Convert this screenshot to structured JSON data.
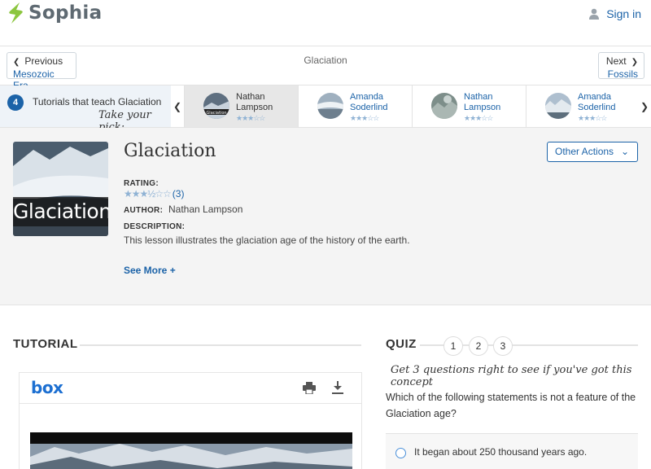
{
  "brand": {
    "name": "Sophia",
    "logo_color": "#8cc63f",
    "text_color": "#5f6a72"
  },
  "header": {
    "signin_label": "Sign in"
  },
  "nav": {
    "prev_label": "Previous",
    "prev_target": "Mesozoic Era",
    "current": "Glaciation",
    "next_label": "Next",
    "next_target": "Fossils"
  },
  "strip": {
    "count": "4",
    "label": "Tutorials that teach Glaciation",
    "handwritten": "Take your pick:",
    "tutorials": [
      {
        "first": "Nathan",
        "last": "Lampson",
        "stars": "★★★☆☆",
        "active": true
      },
      {
        "first": "Amanda",
        "last": "Soderlind",
        "stars": "★★★☆☆",
        "active": false
      },
      {
        "first": "Nathan",
        "last": "Lampson",
        "stars": "★★★☆☆",
        "active": false
      },
      {
        "first": "Amanda",
        "last": "Soderlind",
        "stars": "★★★☆☆",
        "active": false
      }
    ]
  },
  "lesson": {
    "cover_caption": "Glaciation",
    "title": "Glaciation",
    "rating_label": "RATING:",
    "rating_stars": "★★★½☆☆",
    "rating_count": "(3)",
    "author_label": "AUTHOR:",
    "author": "Nathan Lampson",
    "description_label": "DESCRIPTION:",
    "description": "This lesson illustrates the glaciation age of the history of the earth.",
    "see_more": "See More +",
    "actions_label": "Other Actions"
  },
  "tutorial": {
    "heading": "TUTORIAL",
    "viewer_brand": "box"
  },
  "quiz": {
    "heading": "QUIZ",
    "steps": [
      "1",
      "2",
      "3"
    ],
    "handwritten": "Get 3 questions right to see if you've got this concept",
    "question": "Which of the following statements is not a feature of the Glaciation age?",
    "answers": [
      "It began about 250 thousand years ago."
    ]
  },
  "colors": {
    "link": "#1c63a8",
    "star": "#8fb2d4",
    "panel": "#f4f4f4"
  },
  "icons": [
    "sophia-logo-icon",
    "user-icon",
    "chevron-left-icon",
    "chevron-right-icon",
    "chevron-down-icon",
    "print-icon",
    "download-icon"
  ]
}
